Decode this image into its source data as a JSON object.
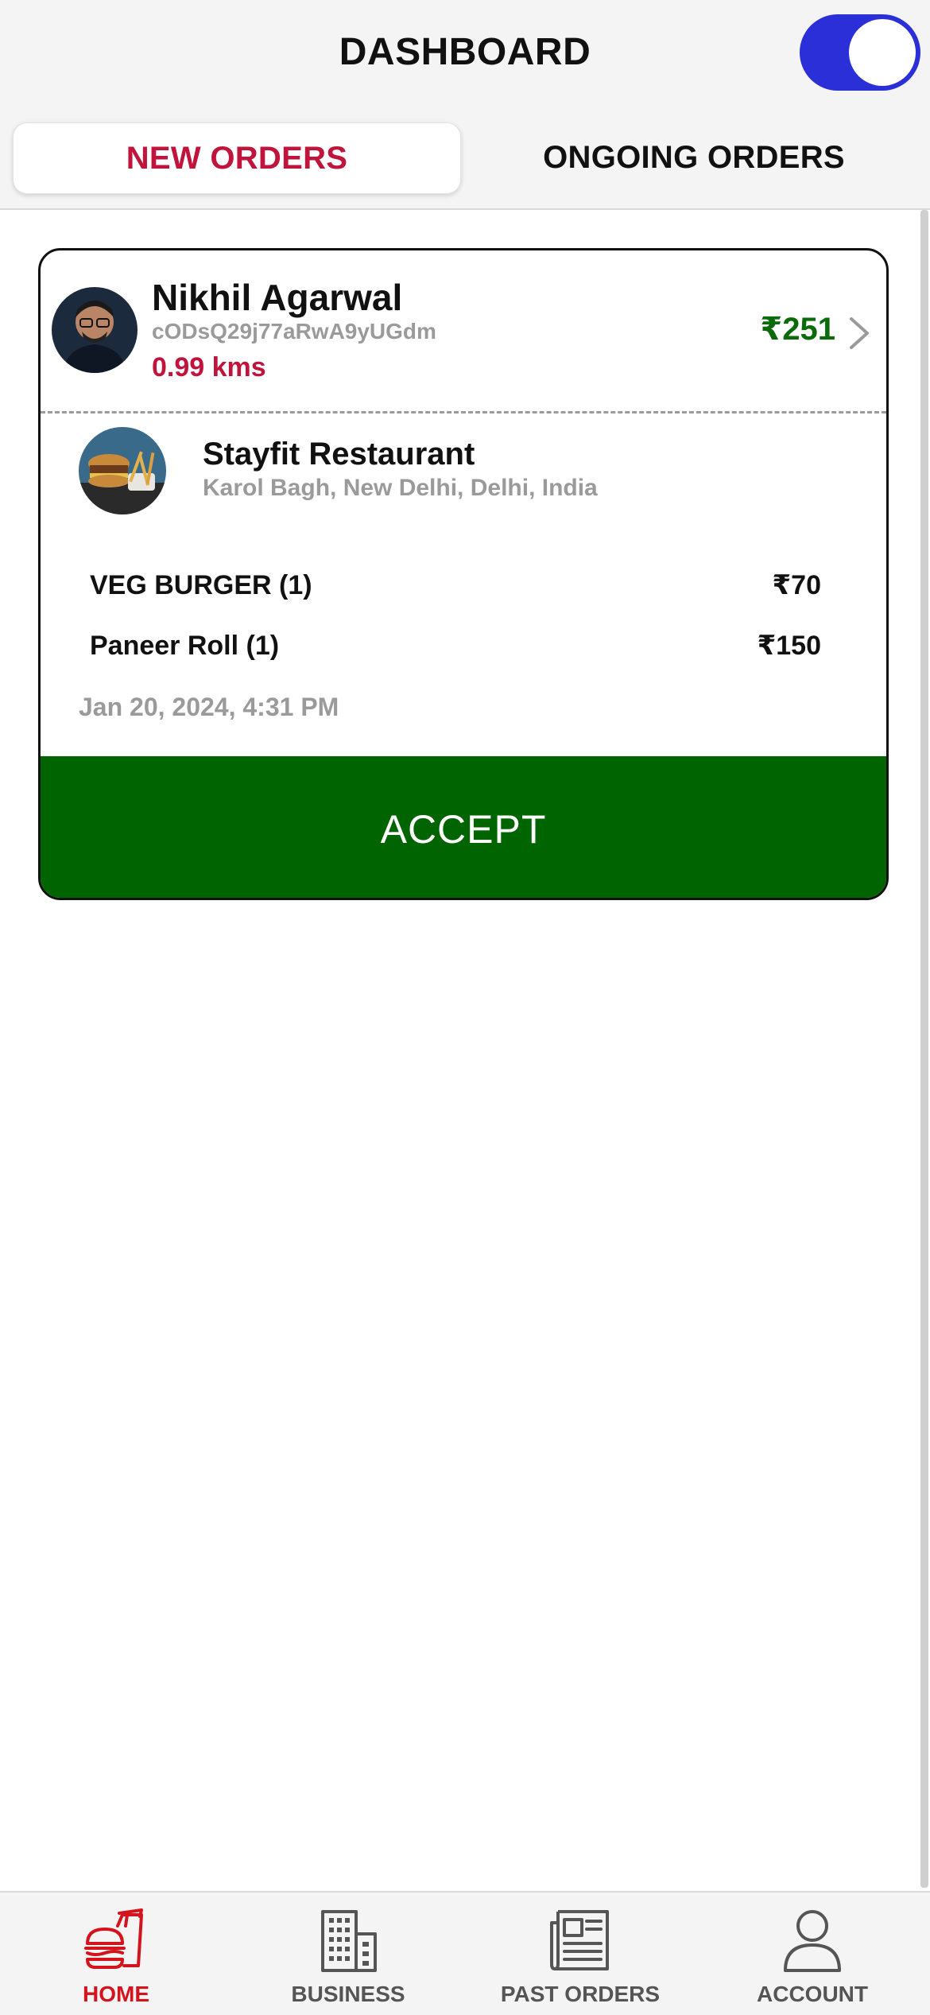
{
  "header": {
    "title": "DASHBOARD",
    "online_toggle": true,
    "toggle_color": "#2a2fd8"
  },
  "tabs": [
    {
      "label": "NEW ORDERS",
      "active": true
    },
    {
      "label": "ONGOING ORDERS",
      "active": false
    }
  ],
  "order": {
    "customer": {
      "name": "Nikhil Agarwal",
      "id": "cODsQ29j77aRwA9yUGdm",
      "distance": "0.99 kms"
    },
    "total": "₹251",
    "restaurant": {
      "name": "Stayfit Restaurant",
      "address": "Karol Bagh, New Delhi, Delhi, India"
    },
    "items": [
      {
        "name": "VEG BURGER (1)",
        "price": "₹70"
      },
      {
        "name": "Paneer Roll (1)",
        "price": "₹150"
      }
    ],
    "time": "Jan 20, 2024, 4:31 PM",
    "accept_label": "ACCEPT"
  },
  "nav": [
    {
      "label": "HOME",
      "icon": "burger-icon",
      "active": true
    },
    {
      "label": "BUSINESS",
      "icon": "building-icon",
      "active": false
    },
    {
      "label": "PAST ORDERS",
      "icon": "newspaper-icon",
      "active": false
    },
    {
      "label": "ACCOUNT",
      "icon": "user-icon",
      "active": false
    }
  ],
  "colors": {
    "accent_red": "#c0143c",
    "accept_green": "#006400",
    "price_green": "#0b6b0b"
  }
}
